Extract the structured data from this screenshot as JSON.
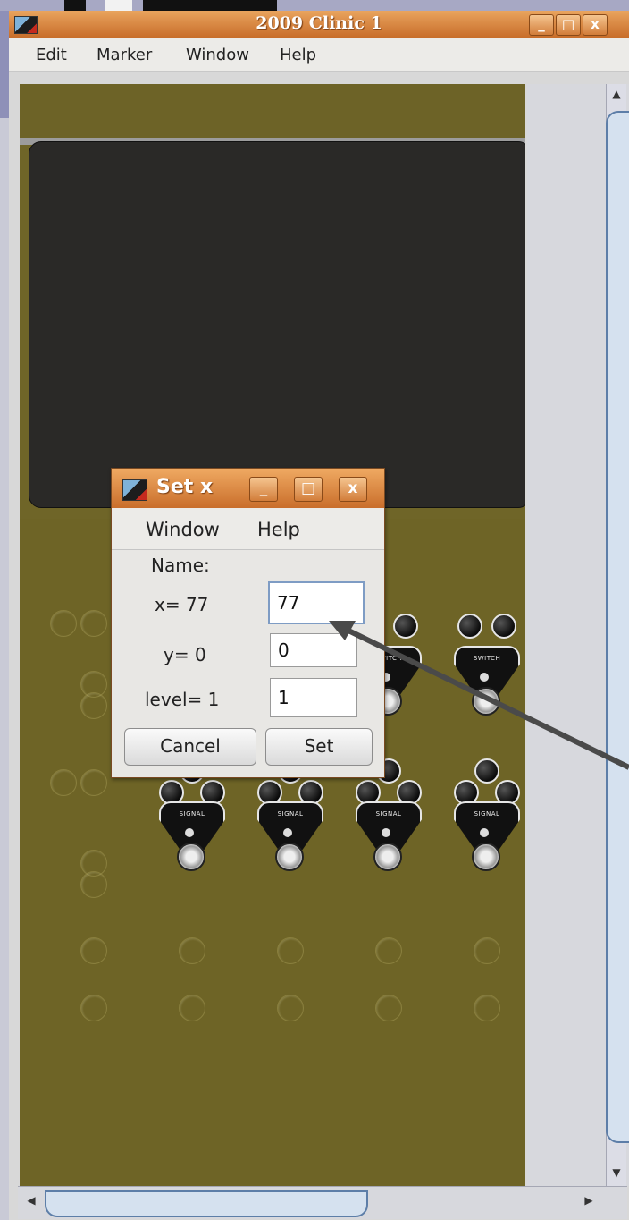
{
  "window": {
    "title": "2009 Clinic 1",
    "controls": {
      "minimize": "_",
      "maximize": "□",
      "close": "x"
    }
  },
  "menubar": {
    "items": [
      "Edit",
      "Marker",
      "Window",
      "Help"
    ]
  },
  "panel": {
    "switch_label": "SWITCH",
    "signal_label": "SIGNAL"
  },
  "dialog": {
    "title": "Set x",
    "controls": {
      "minimize": "_",
      "maximize": "□",
      "close": "x"
    },
    "menu": [
      "Window",
      "Help"
    ],
    "name_label": "Name:",
    "x_label": "x= 77",
    "x_value": "77",
    "y_label": "y= 0",
    "y_value": "0",
    "level_label": "level= 1",
    "level_value": "1",
    "cancel_label": "Cancel",
    "set_label": "Set"
  },
  "colors": {
    "titlebar": "#d9823e",
    "panel": "#6e6426",
    "screen": "#2a2927"
  }
}
